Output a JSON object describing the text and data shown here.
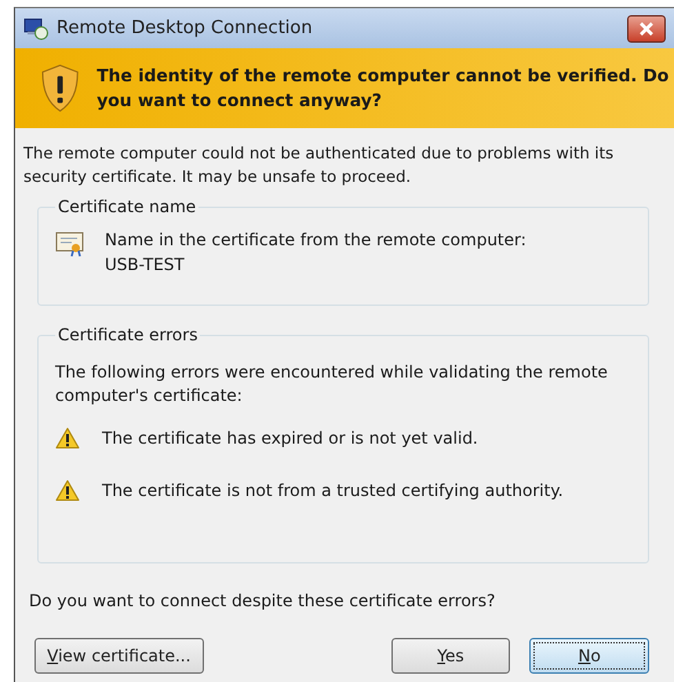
{
  "window": {
    "title": "Remote Desktop Connection"
  },
  "banner": {
    "text": "The identity of the remote computer cannot be verified. Do you want to connect anyway?"
  },
  "intro": "The remote computer could not be authenticated due to problems with its security certificate. It may be unsafe to proceed.",
  "certificate_name": {
    "title": "Certificate name",
    "label": "Name in the certificate from the remote computer:",
    "value": "USB-TEST"
  },
  "certificate_errors": {
    "title": "Certificate errors",
    "intro": "The following errors were encountered while validating the remote computer's certificate:",
    "errors": [
      {
        "text": "The certificate has expired or is not yet valid."
      },
      {
        "text": "The certificate is not from a trusted certifying authority."
      }
    ]
  },
  "question": "Do you want to connect despite these certificate errors?",
  "buttons": [
    {
      "label": "View certificate...",
      "access_key": true,
      "default": false
    },
    {
      "label": "Yes",
      "access_key": true,
      "default": false
    },
    {
      "label": "No",
      "access_key": true,
      "default": true
    }
  ]
}
